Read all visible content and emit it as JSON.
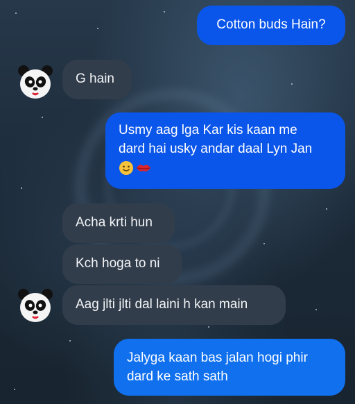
{
  "messages": [
    {
      "id": "m1",
      "direction": "outgoing",
      "text": "Cotton buds Hain?"
    },
    {
      "id": "m2",
      "direction": "incoming",
      "text": "G hain"
    },
    {
      "id": "m3",
      "direction": "outgoing",
      "lines": [
        "Usmy aag lga Kar kis kaan me",
        "dard hai usky andar daal Lyn Jan"
      ],
      "emojis": [
        "smiling-face-emoji",
        "kiss-mark-emoji"
      ]
    },
    {
      "id": "m4",
      "direction": "incoming",
      "text": "Acha krti hun"
    },
    {
      "id": "m5",
      "direction": "incoming",
      "text": "Kch hoga to ni"
    },
    {
      "id": "m6",
      "direction": "incoming",
      "text": "Aag jlti jlti dal laini h kan main"
    },
    {
      "id": "m7",
      "direction": "outgoing",
      "lines": [
        "Jalyga kaan bas jalan hogi phir",
        "dard ke sath sath"
      ]
    }
  ],
  "avatar": {
    "icon": "panda-avatar-icon"
  },
  "colors": {
    "outgoing": "#0a55ea",
    "outgoing_light": "#1070ee",
    "incoming": "#323d4c",
    "background": "#1f2e3e"
  }
}
